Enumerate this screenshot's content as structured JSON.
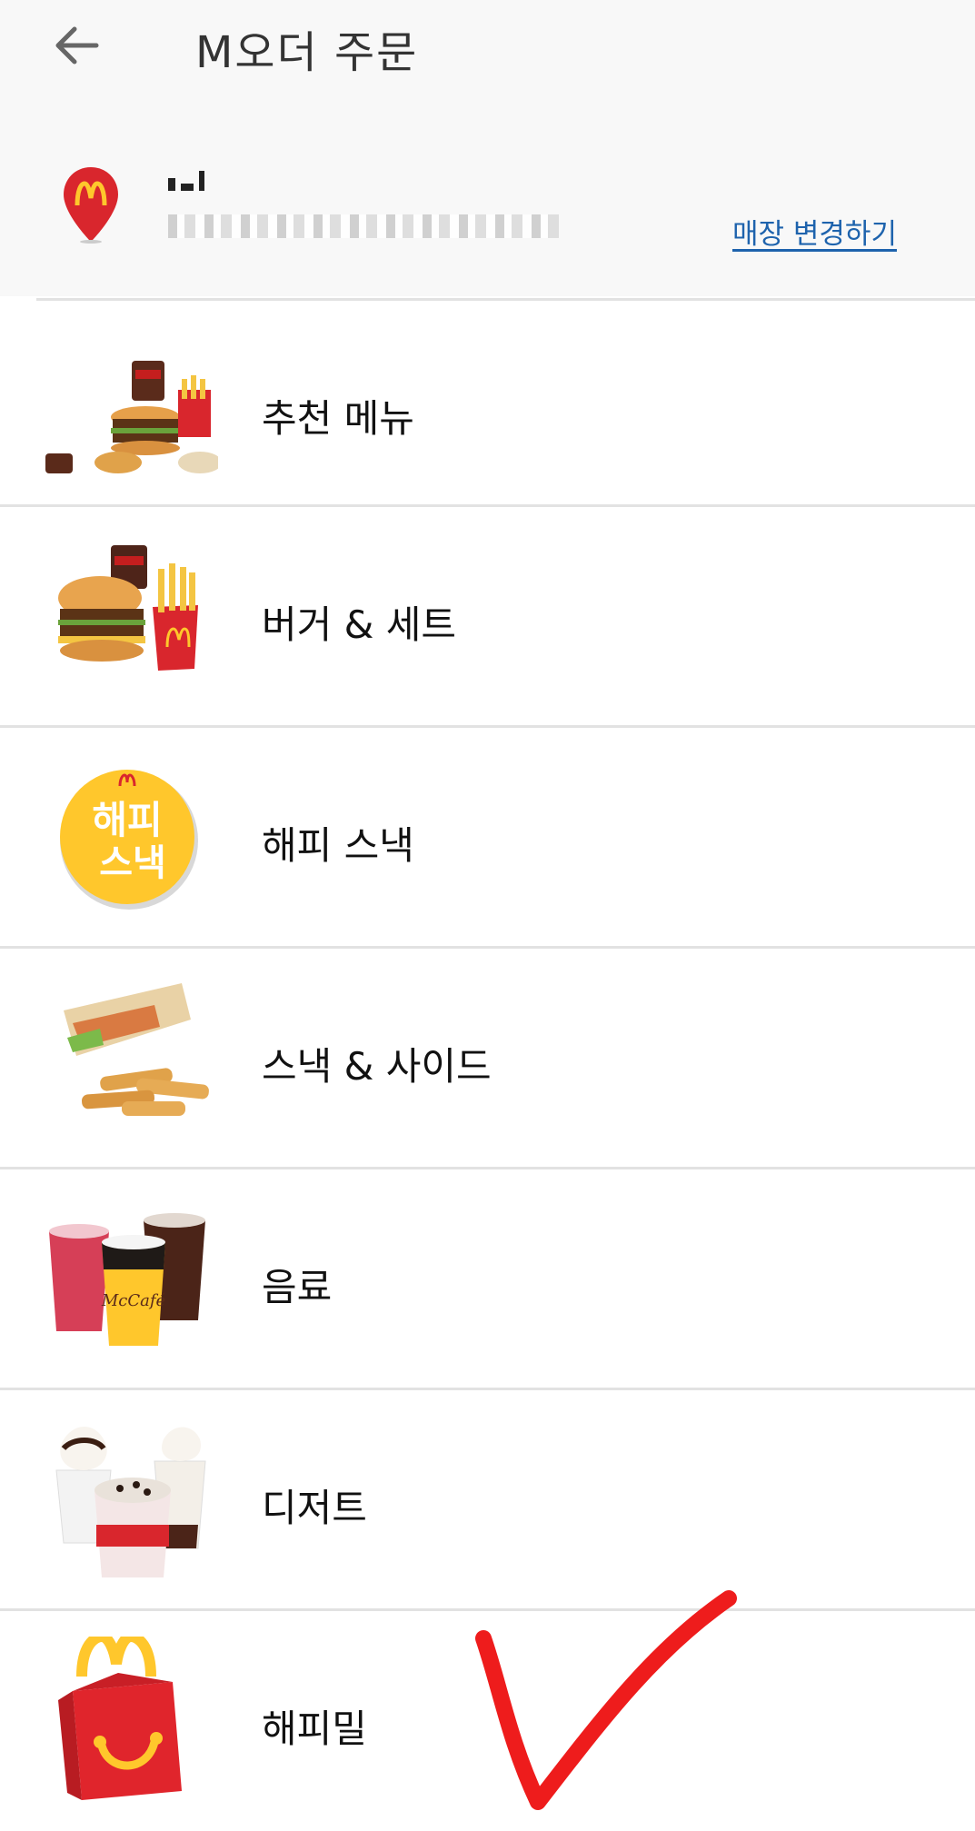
{
  "header": {
    "title": "M오더 주문",
    "back_icon": "arrow-left-icon"
  },
  "store": {
    "change_label": "매장 변경하기",
    "pin_icon": "mcdonalds-location-pin-icon"
  },
  "menu": {
    "items": [
      {
        "label": "추천 메뉴",
        "image": "recommended-menu-image"
      },
      {
        "label": "버거 & 세트",
        "image": "burger-set-image"
      },
      {
        "label": "해피 스낵",
        "image": "happy-snack-image"
      },
      {
        "label": "스낵 & 사이드",
        "image": "snack-side-image"
      },
      {
        "label": "음료",
        "image": "drinks-image"
      },
      {
        "label": "디저트",
        "image": "dessert-image"
      },
      {
        "label": "해피밀",
        "image": "happy-meal-image"
      }
    ]
  },
  "colors": {
    "brand_red": "#d9262d",
    "golden": "#ffc72c",
    "link_blue": "#1e63ad",
    "check_red": "#ee1c1c"
  }
}
